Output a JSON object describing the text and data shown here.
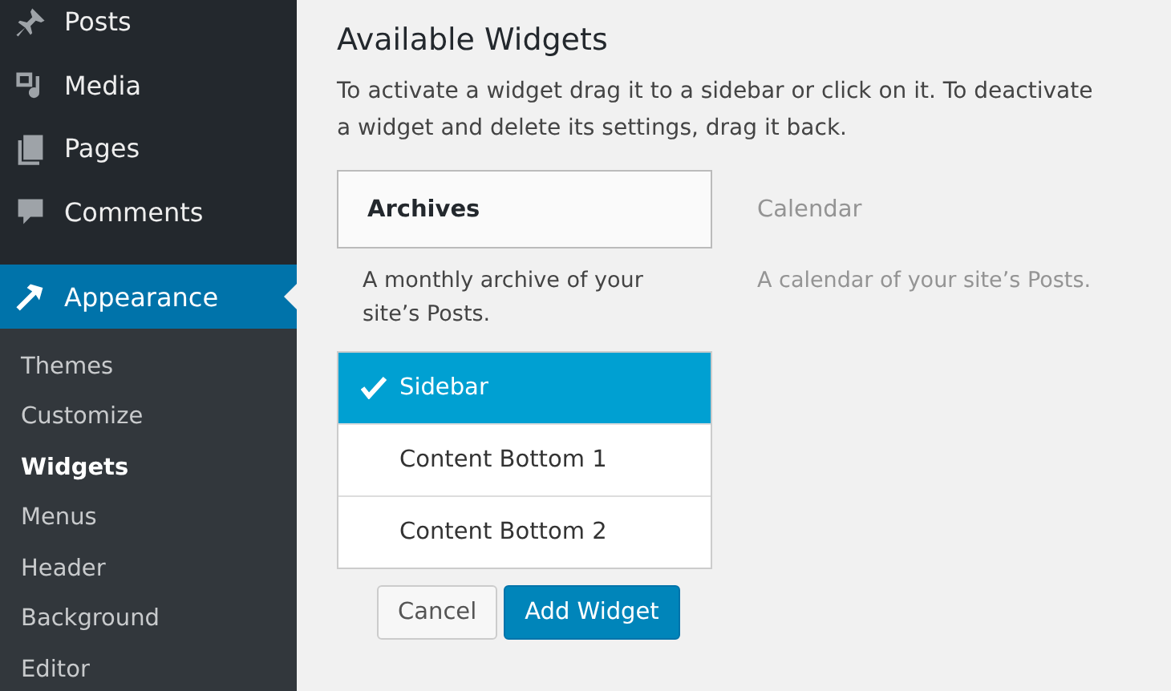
{
  "admin_menu": {
    "items": [
      {
        "label": "Posts",
        "selected": false
      },
      {
        "label": "Media",
        "selected": false
      },
      {
        "label": "Pages",
        "selected": false
      },
      {
        "label": "Comments",
        "selected": false
      },
      {
        "label": "Appearance",
        "selected": true
      }
    ],
    "submenu": [
      {
        "label": "Themes",
        "selected": false
      },
      {
        "label": "Customize",
        "selected": false
      },
      {
        "label": "Widgets",
        "selected": true
      },
      {
        "label": "Menus",
        "selected": false
      },
      {
        "label": "Header",
        "selected": false
      },
      {
        "label": "Background",
        "selected": false
      },
      {
        "label": "Editor",
        "selected": false
      }
    ]
  },
  "available_widgets": {
    "title": "Available Widgets",
    "description": "To activate a widget drag it to a sidebar or click on it. To deactivate a widget and delete its settings, drag it back.",
    "widgets": [
      {
        "name": "Archives",
        "description": "A monthly archive of your site’s Posts.",
        "selected": true
      },
      {
        "name": "Calendar",
        "description": "A calendar of your site’s Posts.",
        "selected": false
      }
    ],
    "sidebars": [
      {
        "label": "Sidebar",
        "selected": true
      },
      {
        "label": "Content Bottom 1",
        "selected": false
      },
      {
        "label": "Content Bottom 2",
        "selected": false
      }
    ],
    "buttons": [
      {
        "label": "Cancel",
        "kind": "secondary"
      },
      {
        "label": "Add Widget",
        "kind": "primary"
      }
    ]
  }
}
